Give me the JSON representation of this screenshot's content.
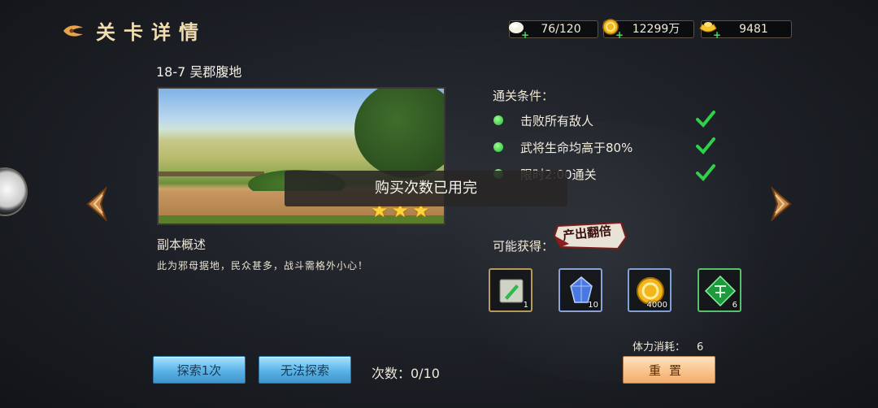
{
  "header": {
    "title": "关卡详情",
    "resources": [
      {
        "icon": "pearl-icon",
        "value": "76/120"
      },
      {
        "icon": "gold-coin-icon",
        "value": "12299万"
      },
      {
        "icon": "gold-ingot-icon",
        "value": "9481"
      }
    ]
  },
  "stage": {
    "name": "18-7 吴郡腹地",
    "stars": 3,
    "overview_label": "副本概述",
    "description": "此为邪母据地，民众甚多，战斗需格外小心！"
  },
  "conditions": {
    "title": "通关条件：",
    "items": [
      {
        "text": "击败所有敌人",
        "done": true
      },
      {
        "text": "武将生命均高于80%",
        "done": true
      },
      {
        "text": "限时2:00通关",
        "done": true
      }
    ]
  },
  "rewards": {
    "title": "可能获得：",
    "badge": "产出翻倍",
    "items": [
      {
        "icon": "scroll-icon",
        "count": "1"
      },
      {
        "icon": "blue-crystal-icon",
        "count": "10"
      },
      {
        "icon": "gold-coin-icon",
        "count": "4000"
      },
      {
        "icon": "green-jade-icon",
        "count": "6"
      }
    ]
  },
  "toast": "购买次数已用完",
  "actions": {
    "explore_once": "探索1次",
    "cannot_explore": "无法探索",
    "tries": "次数：0/10",
    "stamina_label": "体力消耗：",
    "stamina_value": "6",
    "reset": "重置"
  },
  "colors": {
    "title_gold": "#f2ddb0",
    "star": "#ffd23a",
    "check_green": "#2fd04a",
    "button_blue": "#5ab2e6",
    "button_orange": "#f8c48c"
  }
}
